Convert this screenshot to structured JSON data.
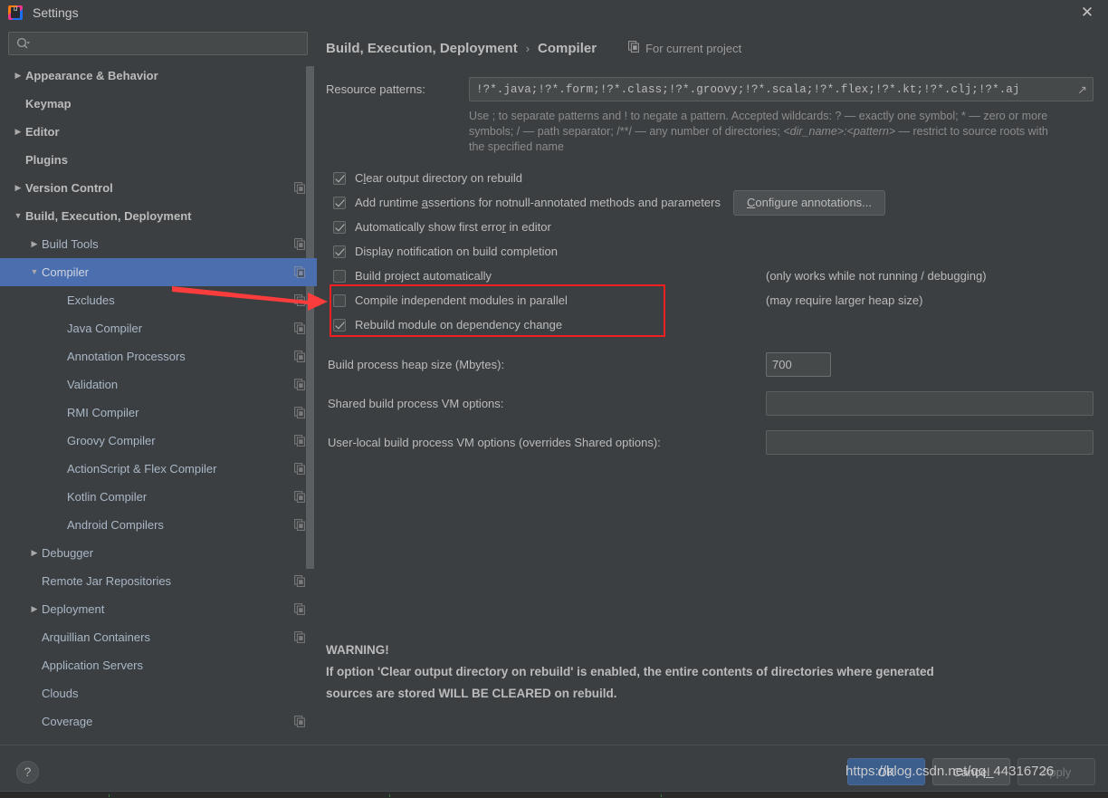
{
  "window": {
    "title": "Settings",
    "logo_icon": "intellij-idea-logo",
    "close_icon": "close-icon"
  },
  "sidebar": {
    "search": {
      "placeholder": "",
      "value": "",
      "icon": "search-icon",
      "dropdown_icon": "chevron-down-icon"
    },
    "items": [
      {
        "label": "Appearance & Behavior",
        "level": 0,
        "arrow": "collapsed",
        "bold": true,
        "copy": false,
        "selected": false
      },
      {
        "label": "Keymap",
        "level": 0,
        "arrow": "none",
        "bold": true,
        "copy": false,
        "selected": false
      },
      {
        "label": "Editor",
        "level": 0,
        "arrow": "collapsed",
        "bold": true,
        "copy": false,
        "selected": false
      },
      {
        "label": "Plugins",
        "level": 0,
        "arrow": "none",
        "bold": true,
        "copy": false,
        "selected": false
      },
      {
        "label": "Version Control",
        "level": 0,
        "arrow": "collapsed",
        "bold": true,
        "copy": true,
        "selected": false
      },
      {
        "label": "Build, Execution, Deployment",
        "level": 0,
        "arrow": "expanded",
        "bold": true,
        "copy": false,
        "selected": false
      },
      {
        "label": "Build Tools",
        "level": 1,
        "arrow": "collapsed",
        "bold": false,
        "copy": true,
        "selected": false
      },
      {
        "label": "Compiler",
        "level": 1,
        "arrow": "expanded",
        "bold": false,
        "copy": true,
        "selected": true
      },
      {
        "label": "Excludes",
        "level": 2,
        "arrow": "none",
        "bold": false,
        "copy": true,
        "selected": false
      },
      {
        "label": "Java Compiler",
        "level": 2,
        "arrow": "none",
        "bold": false,
        "copy": true,
        "selected": false
      },
      {
        "label": "Annotation Processors",
        "level": 2,
        "arrow": "none",
        "bold": false,
        "copy": true,
        "selected": false
      },
      {
        "label": "Validation",
        "level": 2,
        "arrow": "none",
        "bold": false,
        "copy": true,
        "selected": false
      },
      {
        "label": "RMI Compiler",
        "level": 2,
        "arrow": "none",
        "bold": false,
        "copy": true,
        "selected": false
      },
      {
        "label": "Groovy Compiler",
        "level": 2,
        "arrow": "none",
        "bold": false,
        "copy": true,
        "selected": false
      },
      {
        "label": "ActionScript & Flex Compiler",
        "level": 2,
        "arrow": "none",
        "bold": false,
        "copy": true,
        "selected": false
      },
      {
        "label": "Kotlin Compiler",
        "level": 2,
        "arrow": "none",
        "bold": false,
        "copy": true,
        "selected": false
      },
      {
        "label": "Android Compilers",
        "level": 2,
        "arrow": "none",
        "bold": false,
        "copy": true,
        "selected": false
      },
      {
        "label": "Debugger",
        "level": 1,
        "arrow": "collapsed",
        "bold": false,
        "copy": false,
        "selected": false
      },
      {
        "label": "Remote Jar Repositories",
        "level": 1,
        "arrow": "none",
        "bold": false,
        "copy": true,
        "selected": false
      },
      {
        "label": "Deployment",
        "level": 1,
        "arrow": "collapsed",
        "bold": false,
        "copy": true,
        "selected": false
      },
      {
        "label": "Arquillian Containers",
        "level": 1,
        "arrow": "none",
        "bold": false,
        "copy": true,
        "selected": false
      },
      {
        "label": "Application Servers",
        "level": 1,
        "arrow": "none",
        "bold": false,
        "copy": false,
        "selected": false
      },
      {
        "label": "Clouds",
        "level": 1,
        "arrow": "none",
        "bold": false,
        "copy": false,
        "selected": false
      },
      {
        "label": "Coverage",
        "level": 1,
        "arrow": "none",
        "bold": false,
        "copy": true,
        "selected": false
      }
    ]
  },
  "content": {
    "breadcrumb": {
      "parent": "Build, Execution, Deployment",
      "separator": "›",
      "current": "Compiler"
    },
    "for_project": {
      "label": "For current project",
      "icon": "copy-icon"
    },
    "resource_patterns": {
      "label": "Resource patterns:",
      "value": "!?*.java;!?*.form;!?*.class;!?*.groovy;!?*.scala;!?*.flex;!?*.kt;!?*.clj;!?*.aj",
      "expand_icon": "expand-icon"
    },
    "hint_line1": "Use ; to separate patterns and ! to negate a pattern. Accepted wildcards: ? — exactly one symbol; * — zero or",
    "hint_line2_a": "more symbols; / — path separator; /**/ — any number of directories;  ",
    "hint_line2_i": "<dir_name>:<pattern>",
    "hint_line2_b": " — restrict to",
    "hint_line3": "source roots with the specified name",
    "checkboxes": [
      {
        "label": "Clear output directory on rebuild",
        "checked": true,
        "mnemonic": 1,
        "note": ""
      },
      {
        "label": "Add runtime assertions for notnull-annotated methods and parameters",
        "checked": true,
        "mnemonic": 12,
        "note": ""
      },
      {
        "label": "Automatically show first error in editor",
        "checked": true,
        "mnemonic": 29,
        "note": ""
      },
      {
        "label": "Display notification on build completion",
        "checked": true,
        "mnemonic": -1,
        "note": ""
      },
      {
        "label": "Build project automatically",
        "checked": false,
        "mnemonic": -1,
        "note": "(only works while not running / debugging)"
      },
      {
        "label": "Compile independent modules in parallel",
        "checked": false,
        "mnemonic": -1,
        "note": "(may require larger heap size)"
      },
      {
        "label": "Rebuild module on dependency change",
        "checked": true,
        "mnemonic": -1,
        "note": ""
      }
    ],
    "configure_annotations_button": "Configure annotations...",
    "heap": {
      "label": "Build process heap size (Mbytes):",
      "value": "700"
    },
    "shared_vm": {
      "label": "Shared build process VM options:",
      "value": ""
    },
    "local_vm": {
      "label": "User-local build process VM options (overrides Shared options):",
      "value": ""
    },
    "warning": {
      "title": "WARNING!",
      "line1": "If option 'Clear output directory on rebuild' is enabled, the entire contents of directories where generated",
      "line2": "sources are stored WILL BE CLEARED on rebuild."
    }
  },
  "footer": {
    "help_label": "?",
    "ok": "OK",
    "cancel": "Cancel",
    "apply": "Apply"
  },
  "annotations": {
    "watermark": "https://blog.csdn.net/qq_44316726",
    "highlight_color": "#f02020",
    "arrow_color": "#fa3c3c"
  },
  "colors": {
    "background": "#3c3f41",
    "selection": "#4b6eaf",
    "primary_button": "#3c5e8c",
    "text": "#bbbbbb",
    "tree_text": "#a9b7c6"
  }
}
